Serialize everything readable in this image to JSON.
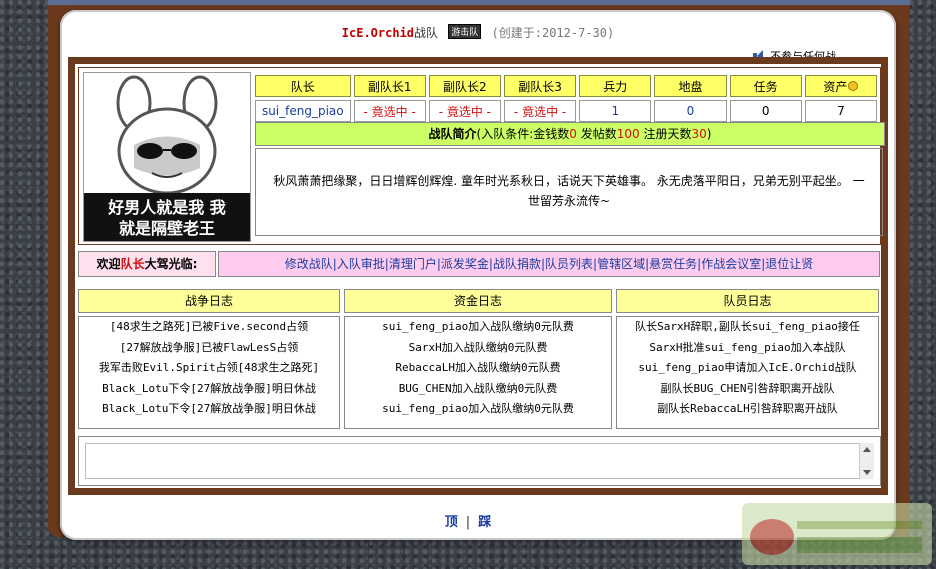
{
  "header": {
    "team_name": "IcE.Orchid",
    "team_suffix": "战队",
    "badge": "游击队",
    "created": "(创建于:2012-7-30)"
  },
  "notice": {
    "text": "不参与任何战"
  },
  "avatar": {
    "caption_line1": "好男人就是我 我",
    "caption_line2": "就是隔壁老王"
  },
  "stats": {
    "headers": [
      "队长",
      "副队长1",
      "副队长2",
      "副队长3",
      "兵力",
      "地盘",
      "任务",
      "资产"
    ],
    "values": [
      "sui_feng_piao",
      "- 竟选中 -",
      "- 竟选中 -",
      "- 竟选中 -",
      "1",
      "0",
      "0",
      "7"
    ]
  },
  "description": {
    "title": "战队简介",
    "condition_prefix": "(入队条件:金钱数",
    "money": "0",
    "posts_label": " 发帖数",
    "posts": "100",
    "days_label": " 注册天数",
    "days": "30",
    "condition_suffix": ")",
    "body": "秋风萧萧把缘聚，日日增辉创辉煌. 童年时光系秋日，话说天下英雄事。 永无虎落平阳日，兄弟无别平起坐。 一世留芳永流传~"
  },
  "welcome": {
    "prefix": "欢迎",
    "role": "队长",
    "suffix": "大驾光临:"
  },
  "admin_links": [
    "修改战队",
    "入队审批",
    "清理门户",
    "派发奖金",
    "战队捐款",
    "队员列表",
    "管辖区域",
    "悬赏任务",
    "作战会议室",
    "退位让贤"
  ],
  "logs": {
    "war": {
      "title": "战争日志",
      "rows": [
        "[48求生之路死]已被Five.second占领",
        "[27解放战争服]已被FlawLesS占领",
        "我军击败Evil.Spirit占领[48求生之路死]",
        "Black_Lotu下令[27解放战争服]明日休战",
        "Black_Lotu下令[27解放战争服]明日休战"
      ]
    },
    "funds": {
      "title": "资金日志",
      "rows": [
        "sui_feng_piao加入战队缴纳0元队费",
        "SarxH加入战队缴纳0元队费",
        "RebaccaLH加入战队缴纳0元队费",
        "BUG_CHEN加入战队缴纳0元队费",
        "sui_feng_piao加入战队缴纳0元队费"
      ]
    },
    "members": {
      "title": "队员日志",
      "rows": [
        "队长SarxH辞职,副队长sui_feng_piao接任",
        "SarxH批准sui_feng_piao加入本战队",
        "sui_feng_piao申请加入IcE.Orchid战队",
        "副队长BUG_CHEN引咎辞职离开战队",
        "副队长RebaccaLH引咎辞职离开战队"
      ]
    }
  },
  "footer": {
    "top": "顶",
    "bottom": "踩"
  },
  "colors": {
    "frame": "#6b3a1e",
    "header_yellow": "#ffff66",
    "desc_green": "#ccff66",
    "admin_pink": "#ffccee",
    "link_blue": "#1a3ea0",
    "alert_red": "#d01010"
  }
}
